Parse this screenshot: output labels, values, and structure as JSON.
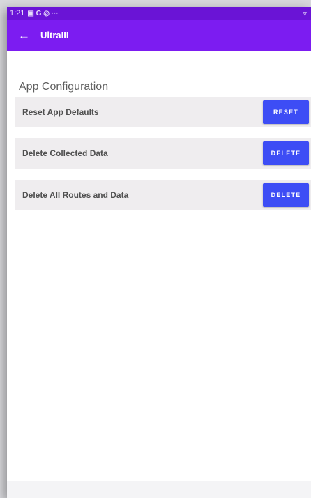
{
  "status_bar": {
    "time": "1:21",
    "notification_icons": "▣ G ◎ ···",
    "system_icons": "▿"
  },
  "app_bar": {
    "title": "UltraIII"
  },
  "section_title": "App Configuration",
  "rows": [
    {
      "label": "Reset App Defaults",
      "button": "RESET"
    },
    {
      "label": "Delete Collected Data",
      "button": "DELETE"
    },
    {
      "label": "Delete All Routes and Data",
      "button": "DELETE"
    }
  ],
  "colors": {
    "status_bar": "#6a14d6",
    "app_bar": "#7c1cf1",
    "button": "#3d4df5",
    "row_bg": "#efedef"
  }
}
